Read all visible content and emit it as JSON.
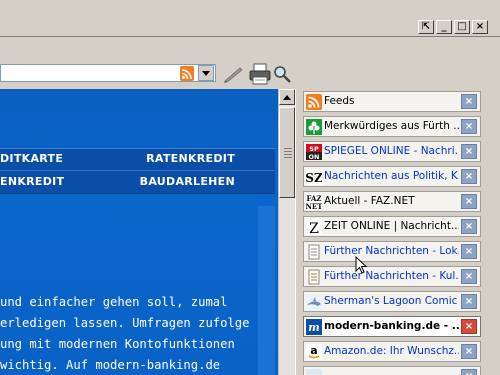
{
  "window": {
    "controls": [
      "⇱",
      "_",
      "□",
      "×"
    ]
  },
  "toolbar": {
    "address_value": "",
    "icons": [
      "rss-icon",
      "dropdown-arrow-icon",
      "pen-icon",
      "printer-icon",
      "magnifier-icon"
    ]
  },
  "content": {
    "nav": {
      "row1_left": "DITKARTE",
      "row1_right": "RATENKREDIT",
      "row2_left": "ENKREDIT",
      "row2_right": "BAUDARLEHEN"
    },
    "body_lines": [
      " und einfacher gehen soll, zumal",
      "erledigen lassen. Umfragen zufolge",
      "ung mit modernen Kontofunktionen",
      "wichtig. Auf modern-banking.de"
    ]
  },
  "sidebar": {
    "feeds": [
      {
        "label": "Feeds",
        "icon": "rss-icon",
        "style": "black",
        "close": "×"
      },
      {
        "label": "Merkwürdiges aus Fürth ...",
        "icon": "shamrock-icon",
        "style": "black",
        "close": "×"
      },
      {
        "label": "SPIEGEL ONLINE - Nachri...",
        "icon": "spiegel-online-icon",
        "style": "blue",
        "close": "×"
      },
      {
        "label": "Nachrichten aus Politik, K...",
        "icon": "sz-icon",
        "style": "blue",
        "close": "×"
      },
      {
        "label": "Aktuell - FAZ.NET",
        "icon": "faz-net-icon",
        "style": "black",
        "close": "×"
      },
      {
        "label": "ZEIT ONLINE | Nachricht...",
        "icon": "zeit-icon",
        "style": "black",
        "close": "×"
      },
      {
        "label": "Fürther Nachrichten - Lok...",
        "icon": "document-icon",
        "style": "blue",
        "close": "×"
      },
      {
        "label": "Fürther Nachrichten - Kul...",
        "icon": "document-icon",
        "style": "blue",
        "close": "×"
      },
      {
        "label": "Sherman's Lagoon Comic ...",
        "icon": "shark-icon",
        "style": "blue",
        "close": "×"
      },
      {
        "label": "modern-banking.de - ...",
        "icon": "modern-banking-icon",
        "style": "bold",
        "close": "×"
      },
      {
        "label": "Amazon.de: Ihr Wunschz...",
        "icon": "amazon-icon",
        "style": "blue",
        "close": "×"
      },
      {
        "label": "",
        "icon": "feed-icon",
        "style": "blue",
        "close": "×"
      }
    ]
  },
  "colors": {
    "content_blue": "#0062c4",
    "nav_band": "#0b4ea8",
    "sidebar_bg": "#d4d0c8",
    "close_button": "#8ea3c4",
    "close_button_active": "#d64a3b"
  }
}
